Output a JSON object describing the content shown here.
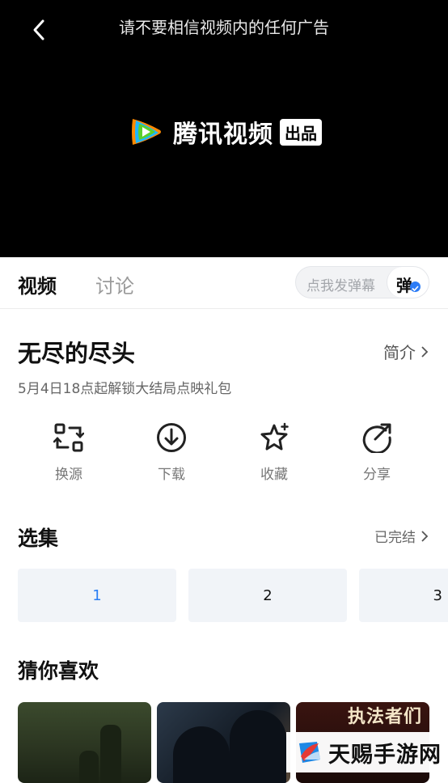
{
  "player": {
    "notice": "请不要相信视频内的任何广告",
    "logo_text": "腾讯视频",
    "logo_badge": "出品"
  },
  "tabs": [
    {
      "label": "视频",
      "active": true
    },
    {
      "label": "讨论",
      "active": false
    }
  ],
  "danmu": {
    "placeholder": "点我发弹幕",
    "button_label": "弹"
  },
  "show": {
    "title": "无尽的尽头",
    "intro_label": "简介",
    "subtitle": "5月4日18点起解锁大结局点映礼包"
  },
  "actions": [
    {
      "label": "换源",
      "icon": "switch-source-icon"
    },
    {
      "label": "下载",
      "icon": "download-icon"
    },
    {
      "label": "收藏",
      "icon": "favorite-star-icon"
    },
    {
      "label": "分享",
      "icon": "share-icon"
    }
  ],
  "episodes": {
    "section_title": "选集",
    "status": "已完结",
    "items": [
      "1",
      "2",
      "3"
    ],
    "selected": "1"
  },
  "recommend": {
    "section_title": "猜你喜欢",
    "poster3_text": "执法者们"
  },
  "watermark": {
    "text": "天赐手游网"
  },
  "colors": {
    "accent": "#2a7ef4",
    "player_bg": "#000000",
    "episode_bg": "#f1f4f8"
  }
}
